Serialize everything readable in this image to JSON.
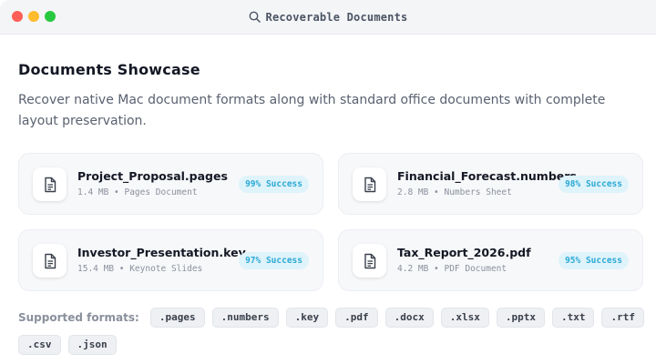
{
  "window": {
    "title": "Recoverable Documents"
  },
  "page": {
    "heading": "Documents Showcase",
    "description": "Recover native Mac document formats along with standard office documents with complete layout preservation."
  },
  "documents": [
    {
      "name": "Project_Proposal.pages",
      "size": "1.4 MB",
      "type": "Pages Document",
      "meta": "1.4 MB • Pages Document",
      "success": "99% Success"
    },
    {
      "name": "Financial_Forecast.numbers",
      "size": "2.8 MB",
      "type": "Numbers Sheet",
      "meta": "2.8 MB • Numbers Sheet",
      "success": "98% Success"
    },
    {
      "name": "Investor_Presentation.key",
      "size": "15.4 MB",
      "type": "Keynote Slides",
      "meta": "15.4 MB • Keynote Slides",
      "success": "97% Success"
    },
    {
      "name": "Tax_Report_2026.pdf",
      "size": "4.2 MB",
      "type": "PDF Document",
      "meta": "4.2 MB • PDF Document",
      "success": "95% Success"
    }
  ],
  "formats": {
    "label": "Supported formats:",
    "items": [
      ".pages",
      ".numbers",
      ".key",
      ".pdf",
      ".docx",
      ".xlsx",
      ".pptx",
      ".txt",
      ".rtf",
      ".csv",
      ".json"
    ]
  },
  "colors": {
    "accent": "#2aa9d6",
    "badge_bg": "#dff3fa",
    "close": "#ff5f57",
    "minimize": "#febc2e",
    "zoom": "#28c840"
  },
  "icons": {
    "title": "search-icon",
    "file": "document-icon"
  }
}
